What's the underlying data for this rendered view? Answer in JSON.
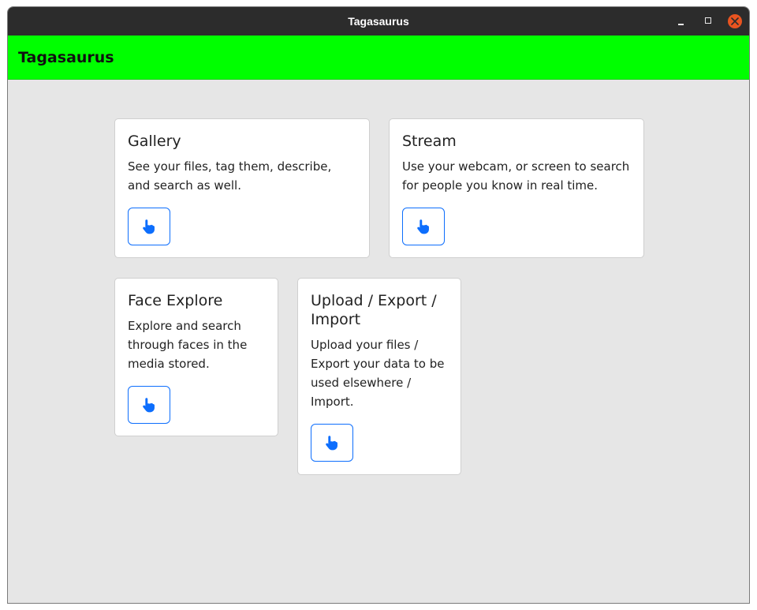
{
  "window": {
    "title": "Tagasaurus"
  },
  "appbar": {
    "brand": "Tagasaurus"
  },
  "colors": {
    "accent": "#0d6efd",
    "appbar_bg": "#00ff00",
    "close_button": "#e95420"
  },
  "cards": [
    {
      "title": "Gallery",
      "description": "See your files, tag them, describe, and search as well.",
      "button_icon": "pointing-hand-icon"
    },
    {
      "title": "Stream",
      "description": "Use your webcam, or screen to search for people you know in real time.",
      "button_icon": "pointing-hand-icon"
    },
    {
      "title": "Face Explore",
      "description": "Explore and search through faces in the media stored.",
      "button_icon": "pointing-hand-icon"
    },
    {
      "title": "Upload / Export / Import",
      "description": "Upload your files / Export your data to be used elsewhere / Import.",
      "button_icon": "pointing-hand-icon"
    }
  ]
}
